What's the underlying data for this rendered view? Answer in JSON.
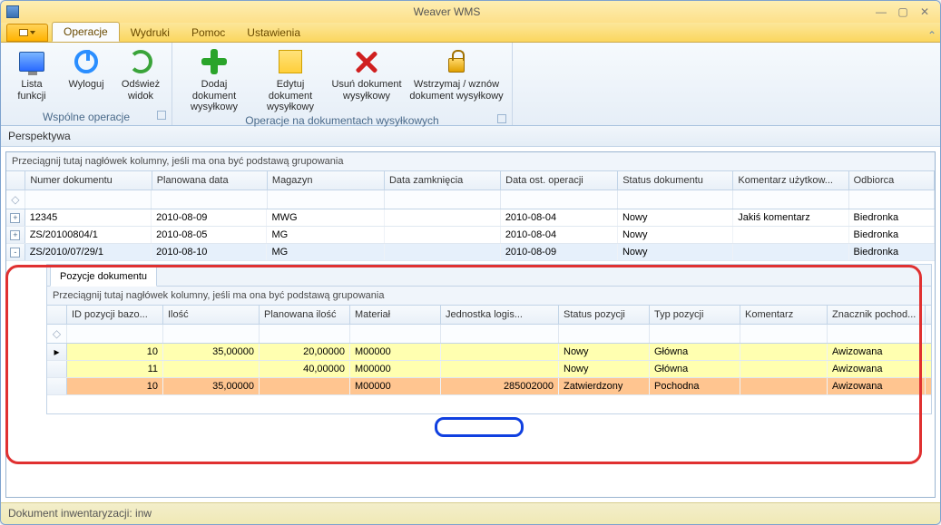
{
  "window": {
    "title": "Weaver WMS"
  },
  "ribbon": {
    "tabs": [
      "Operacje",
      "Wydruki",
      "Pomoc",
      "Ustawienia"
    ],
    "active": 0,
    "groups": [
      {
        "title": "Wspólne operacje",
        "buttons": [
          {
            "label": "Lista\nfunkcji",
            "icon": "monitor"
          },
          {
            "label": "Wyloguj",
            "icon": "power"
          },
          {
            "label": "Odśwież\nwidok",
            "icon": "refresh"
          }
        ]
      },
      {
        "title": "Operacje na dokumentach wysyłkowych",
        "buttons": [
          {
            "label": "Dodaj dokument\nwysyłkowy",
            "icon": "plus"
          },
          {
            "label": "Edytuj dokument\nwysyłkowy",
            "icon": "edit"
          },
          {
            "label": "Usuń dokument\nwysyłkowy",
            "icon": "del"
          },
          {
            "label": "Wstrzymaj / wznów\ndokument wysyłkowy",
            "icon": "lock"
          }
        ]
      }
    ]
  },
  "perspective_label": "Perspektywa",
  "group_hint": "Przeciągnij tutaj nagłówek kolumny, jeśli ma ona być podstawą grupowania",
  "main_columns": [
    "Numer dokumentu",
    "Planowana data",
    "Magazyn",
    "Data zamknięcia",
    "Data ost. operacji",
    "Status dokumentu",
    "Komentarz użytkow...",
    "Odbiorca"
  ],
  "main_rows": [
    {
      "exp": "+",
      "cells": [
        "12345",
        "2010-08-09",
        "MWG",
        "",
        "2010-08-04",
        "Nowy",
        "Jakiś komentarz",
        "Biedronka"
      ]
    },
    {
      "exp": "+",
      "cells": [
        "ZS/20100804/1",
        "2010-08-05",
        "MG",
        "",
        "2010-08-04",
        "Nowy",
        "",
        "Biedronka"
      ]
    },
    {
      "exp": "-",
      "cells": [
        "ZS/2010/07/29/1",
        "2010-08-10",
        "MG",
        "",
        "2010-08-09",
        "Nowy",
        "",
        "Biedronka"
      ],
      "selected": true
    }
  ],
  "detail_tab": "Pozycje dokumentu",
  "detail_columns": [
    "ID pozycji bazo...",
    "Ilość",
    "Planowana ilość",
    "Materiał",
    "Jednostka logis...",
    "Status pozycji",
    "Typ pozycji",
    "Komentarz",
    "Znacznik pochod..."
  ],
  "detail_rows": [
    {
      "cls": "a",
      "ind": "▸",
      "cells": [
        "10",
        "35,00000",
        "20,00000",
        "M00000",
        "",
        "Nowy",
        "Główna",
        "",
        "Awizowana"
      ]
    },
    {
      "cls": "a",
      "ind": "",
      "cells": [
        "11",
        "",
        "40,00000",
        "M00000",
        "",
        "Nowy",
        "Główna",
        "",
        "Awizowana"
      ]
    },
    {
      "cls": "c",
      "ind": "",
      "cells": [
        "10",
        "35,00000",
        "",
        "M00000",
        "285002000",
        "Zatwierdzony",
        "Pochodna",
        "",
        "Awizowana"
      ]
    }
  ],
  "statusbar": "Dokument inwentaryzacji: inw"
}
